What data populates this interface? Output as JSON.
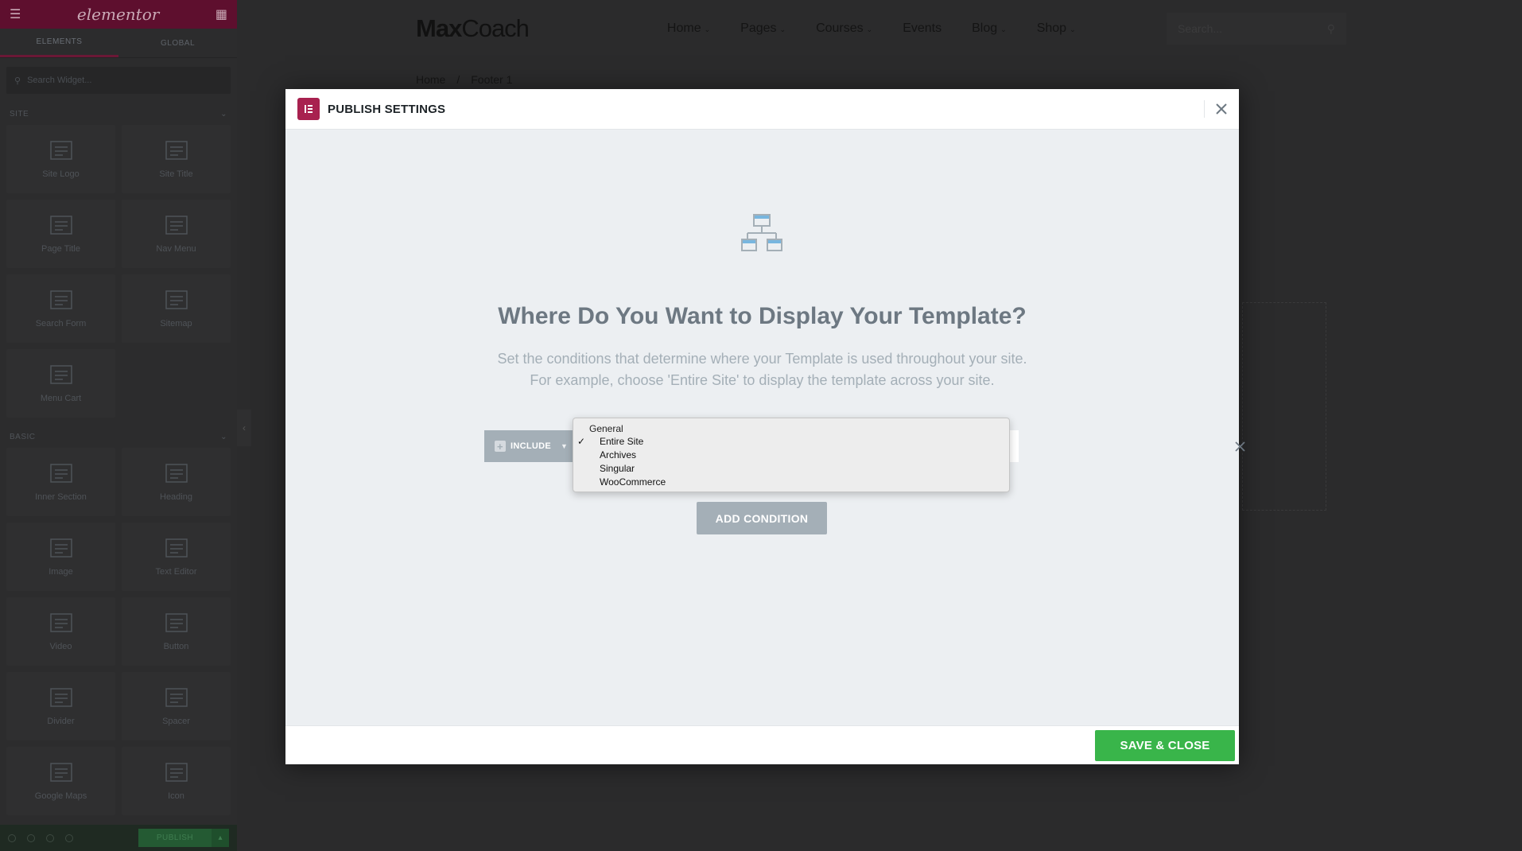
{
  "panel": {
    "logo": "elementor",
    "tabs": [
      "ELEMENTS",
      "GLOBAL"
    ],
    "search_placeholder": "Search Widget...",
    "categories": {
      "site": {
        "label": "SITE",
        "widgets": [
          "Site Logo",
          "Site Title",
          "Page Title",
          "Nav Menu",
          "Search Form",
          "Sitemap",
          "Menu Cart"
        ]
      },
      "basic": {
        "label": "BASIC",
        "widgets": [
          "Inner Section",
          "Heading",
          "Image",
          "Text Editor",
          "Video",
          "Button",
          "Divider",
          "Spacer",
          "Google Maps",
          "Icon"
        ]
      }
    },
    "footer": {
      "publish_label": "PUBLISH"
    }
  },
  "site": {
    "logo_bold": "Max",
    "logo_rest": "Coach",
    "nav": [
      {
        "label": "Home",
        "caret": true
      },
      {
        "label": "Pages",
        "caret": true
      },
      {
        "label": "Courses",
        "caret": true
      },
      {
        "label": "Events",
        "caret": false
      },
      {
        "label": "Blog",
        "caret": true
      },
      {
        "label": "Shop",
        "caret": true
      }
    ],
    "search_placeholder": "Search...",
    "breadcrumb": [
      "Home",
      "/",
      "Footer 1"
    ]
  },
  "modal": {
    "title": "PUBLISH SETTINGS",
    "icon": "sitemap-icon",
    "heading": "Where Do You Want to Display Your Template?",
    "description_line1": "Set the conditions that determine where your Template is used throughout your site.",
    "description_line2": "For example, choose 'Entire Site' to display the template across your site.",
    "condition": {
      "include_label": "INCLUDE",
      "dropdown": {
        "group": "General",
        "options": [
          {
            "label": "Entire Site",
            "selected": true
          },
          {
            "label": "Archives",
            "selected": false
          },
          {
            "label": "Singular",
            "selected": false
          },
          {
            "label": "WooCommerce",
            "selected": false
          }
        ]
      }
    },
    "add_condition_label": "ADD CONDITION",
    "save_close_label": "SAVE & CLOSE"
  },
  "colors": {
    "accent": "#a8214f",
    "save_button": "#39b54a",
    "muted_button": "#a4afb7",
    "heading_text": "#6d7882",
    "panel_header": "#5e0f2e"
  }
}
